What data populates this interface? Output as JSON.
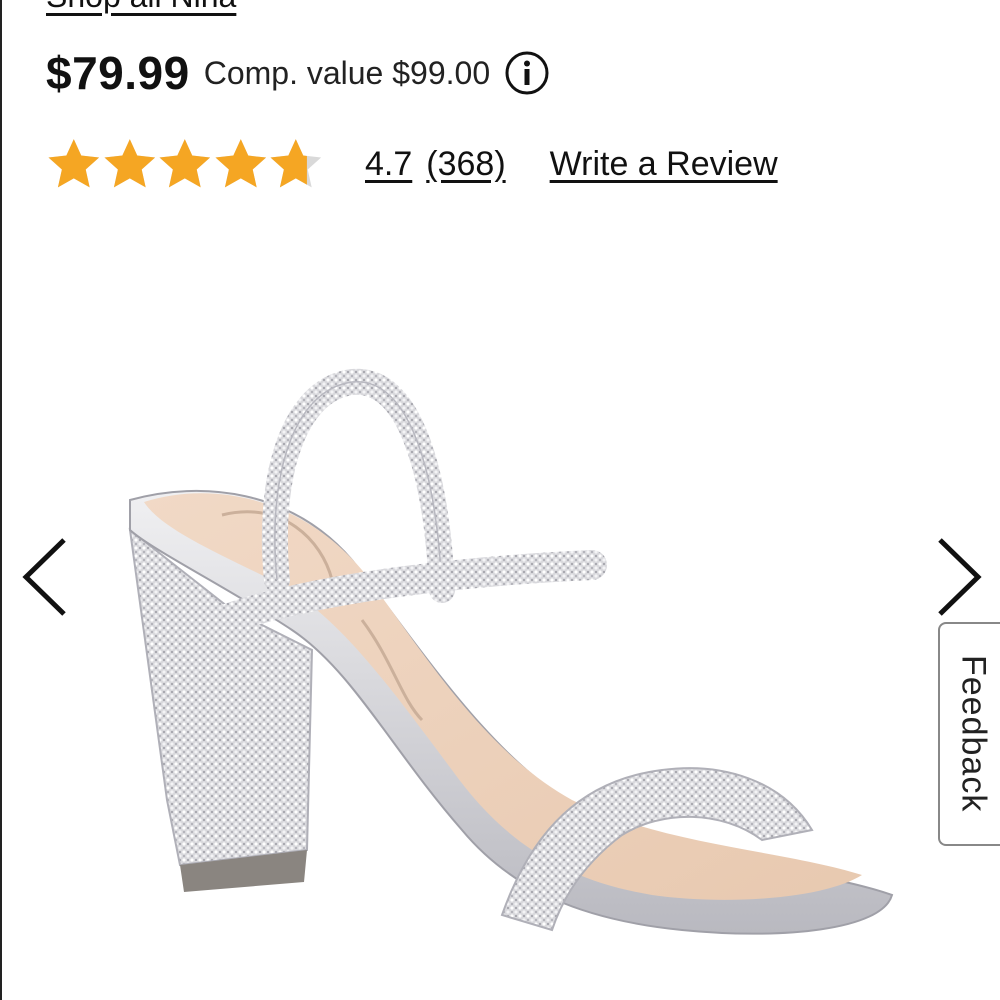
{
  "shop_all_link": "Shop all Nina",
  "price": {
    "current": "$79.99",
    "comp_value": "Comp. value $99.00",
    "info_icon": "info-circle-icon"
  },
  "rating": {
    "stars": 4.7,
    "max_stars": 5,
    "value_text": "4.7",
    "count_text": "(368)",
    "star_color": "#F5A623",
    "empty_star_color": "#D9D9D9"
  },
  "write_review_label": "Write a Review",
  "carousel": {
    "prev_icon": "chevron-left-icon",
    "next_icon": "chevron-right-icon"
  },
  "feedback_label": "Feedback"
}
